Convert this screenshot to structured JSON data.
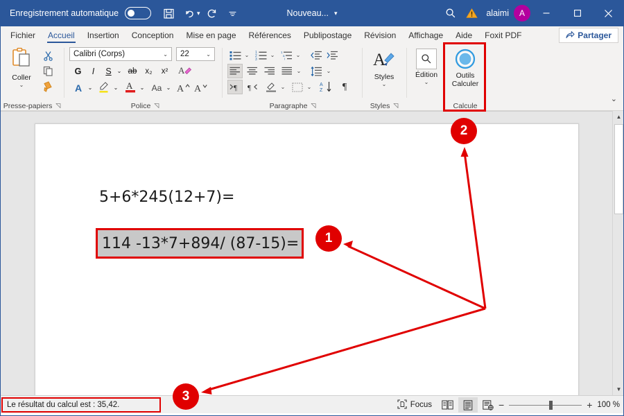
{
  "window": {
    "app": "Microsoft Word",
    "autosave_label": "Enregistrement automatique",
    "autosave_state": "off",
    "document_name": "Nouveau...",
    "user_name": "alaimi",
    "avatar_initial": "A",
    "accent_color": "#2b579a",
    "annotation_color": "#e00000",
    "quick_access": [
      {
        "name": "save-icon",
        "label": "Enregistrer"
      },
      {
        "name": "undo-icon",
        "label": "Annuler"
      },
      {
        "name": "redo-icon",
        "label": "Rétablir"
      },
      {
        "name": "customize-qat-icon",
        "label": "Personnaliser la barre d'outils Accès rapide"
      }
    ],
    "title_icons": [
      {
        "name": "search-icon",
        "label": "Rechercher"
      },
      {
        "name": "warning-icon",
        "label": "Avertissement"
      }
    ],
    "window_controls": [
      {
        "name": "minimize-button",
        "glyph": "—"
      },
      {
        "name": "maximize-button",
        "glyph": "▢"
      },
      {
        "name": "close-button",
        "glyph": "✕"
      }
    ]
  },
  "tabs": [
    {
      "label": "Fichier",
      "active": false
    },
    {
      "label": "Accueil",
      "active": true
    },
    {
      "label": "Insertion",
      "active": false
    },
    {
      "label": "Conception",
      "active": false
    },
    {
      "label": "Mise en page",
      "active": false
    },
    {
      "label": "Références",
      "active": false
    },
    {
      "label": "Publipostage",
      "active": false
    },
    {
      "label": "Révision",
      "active": false
    },
    {
      "label": "Affichage",
      "active": false
    },
    {
      "label": "Aide",
      "active": false
    },
    {
      "label": "Foxit PDF",
      "active": false
    }
  ],
  "share": {
    "label": "Partager",
    "icon": "share-icon"
  },
  "ribbon": {
    "groups": [
      {
        "title": "Presse-papiers",
        "has_launcher": true
      },
      {
        "title": "Police",
        "has_launcher": true
      },
      {
        "title": "Paragraphe",
        "has_launcher": true
      },
      {
        "title": "Styles",
        "has_launcher": true
      },
      {
        "title": "Édition",
        "has_launcher": false
      },
      {
        "title": "Calcule",
        "has_launcher": false
      }
    ],
    "clipboard": {
      "paste_label": "Coller",
      "buttons": [
        {
          "name": "cut-button",
          "label": "Couper"
        },
        {
          "name": "copy-button",
          "label": "Copier"
        },
        {
          "name": "format-painter-button",
          "label": "Reproduire la mise en forme"
        }
      ]
    },
    "font": {
      "font_name": "Calibri (Corps)",
      "font_size": "22",
      "buttons": [
        {
          "name": "bold-button",
          "glyph": "G"
        },
        {
          "name": "italic-button",
          "glyph": "I"
        },
        {
          "name": "underline-button",
          "glyph": "S"
        },
        {
          "name": "strikethrough-button",
          "glyph": "ab"
        },
        {
          "name": "subscript-button",
          "glyph": "x₂"
        },
        {
          "name": "superscript-button",
          "glyph": "x²"
        },
        {
          "name": "clear-formatting-button",
          "glyph": "A"
        },
        {
          "name": "text-effects-button",
          "glyph": "A"
        },
        {
          "name": "text-highlight-button",
          "glyph": "✏"
        },
        {
          "name": "font-color-button",
          "glyph": "A"
        },
        {
          "name": "change-case-button",
          "glyph": "Aa"
        },
        {
          "name": "grow-font-button",
          "glyph": "A"
        },
        {
          "name": "shrink-font-button",
          "glyph": "A"
        }
      ]
    },
    "paragraph": {
      "buttons": [
        {
          "name": "bullets-button"
        },
        {
          "name": "numbering-button"
        },
        {
          "name": "multilevel-list-button"
        },
        {
          "name": "decrease-indent-button"
        },
        {
          "name": "increase-indent-button"
        },
        {
          "name": "align-left-button",
          "selected": true
        },
        {
          "name": "align-center-button"
        },
        {
          "name": "align-right-button"
        },
        {
          "name": "justify-button"
        },
        {
          "name": "line-spacing-button"
        },
        {
          "name": "ltr-text-direction-button",
          "selected": true
        },
        {
          "name": "rtl-text-direction-button"
        },
        {
          "name": "shading-button"
        },
        {
          "name": "borders-button"
        },
        {
          "name": "sort-button"
        },
        {
          "name": "show-formatting-marks-button"
        }
      ]
    },
    "styles": {
      "label": "Styles",
      "icon": "styles-icon"
    },
    "editing": {
      "label": "Édition",
      "icon": "search-icon"
    },
    "calculate": {
      "label_line1": "Outils",
      "label_line2": "Calculer",
      "icon": "calculator-tool-icon"
    },
    "collapse": {
      "name": "collapse-ribbon-button",
      "glyph": "⌄"
    }
  },
  "document": {
    "line1": "5+6*245(12+7)=",
    "line2": "114 -13*7+894/ (87-15)=",
    "line2_selected": true
  },
  "annotations": [
    {
      "number": "1",
      "target": "selected-equation-line"
    },
    {
      "number": "2",
      "target": "outils-calculer-button"
    },
    {
      "number": "3",
      "target": "status-bar-result"
    }
  ],
  "status_bar": {
    "result_text": "Le résultat du calcul est : 35,42.",
    "focus_label": "Focus",
    "view_buttons": [
      {
        "name": "read-mode-button",
        "active": false
      },
      {
        "name": "print-layout-button",
        "active": true
      },
      {
        "name": "web-layout-button",
        "active": false
      }
    ],
    "zoom_out": "−",
    "zoom_in": "+",
    "zoom_level": "100 %"
  }
}
